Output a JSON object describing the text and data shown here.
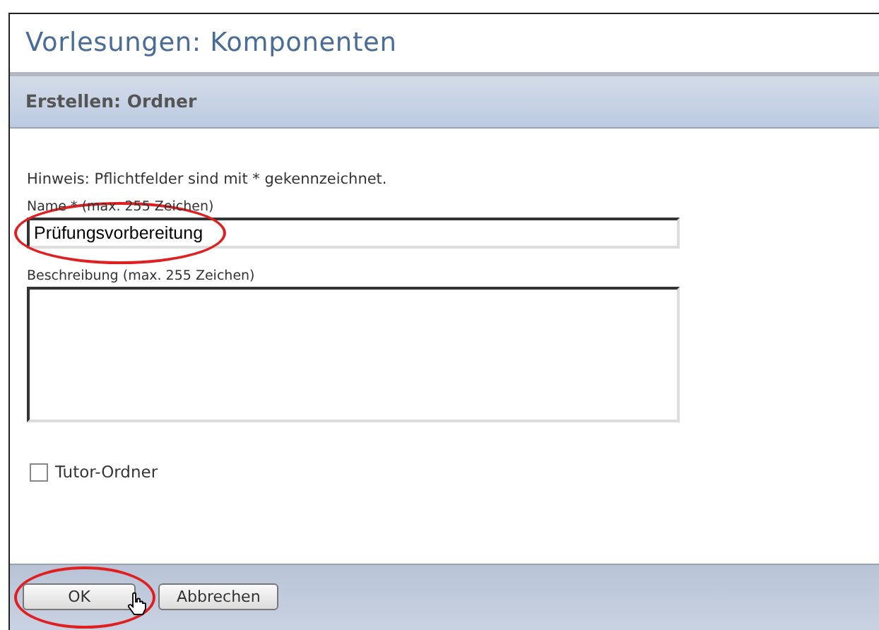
{
  "page_title": "Vorlesungen: Komponenten",
  "section_header": "Erstellen: Ordner",
  "hint": "Hinweis: Pflichtfelder sind mit * gekennzeichnet.",
  "fields": [
    {
      "kind": "input",
      "label": "Name * (max. 255 Zeichen)",
      "value": "Prüfungsvorbereitung",
      "highlighted": true
    },
    {
      "kind": "textarea",
      "label": "Beschreibung  (max. 255 Zeichen)",
      "highlighted": false
    }
  ],
  "checkbox": {
    "label": "Tutor-Ordner",
    "checked": false
  },
  "buttons": [
    {
      "label": "OK",
      "highlighted": true
    },
    {
      "label": "Abbrechen",
      "highlighted": false
    }
  ]
}
